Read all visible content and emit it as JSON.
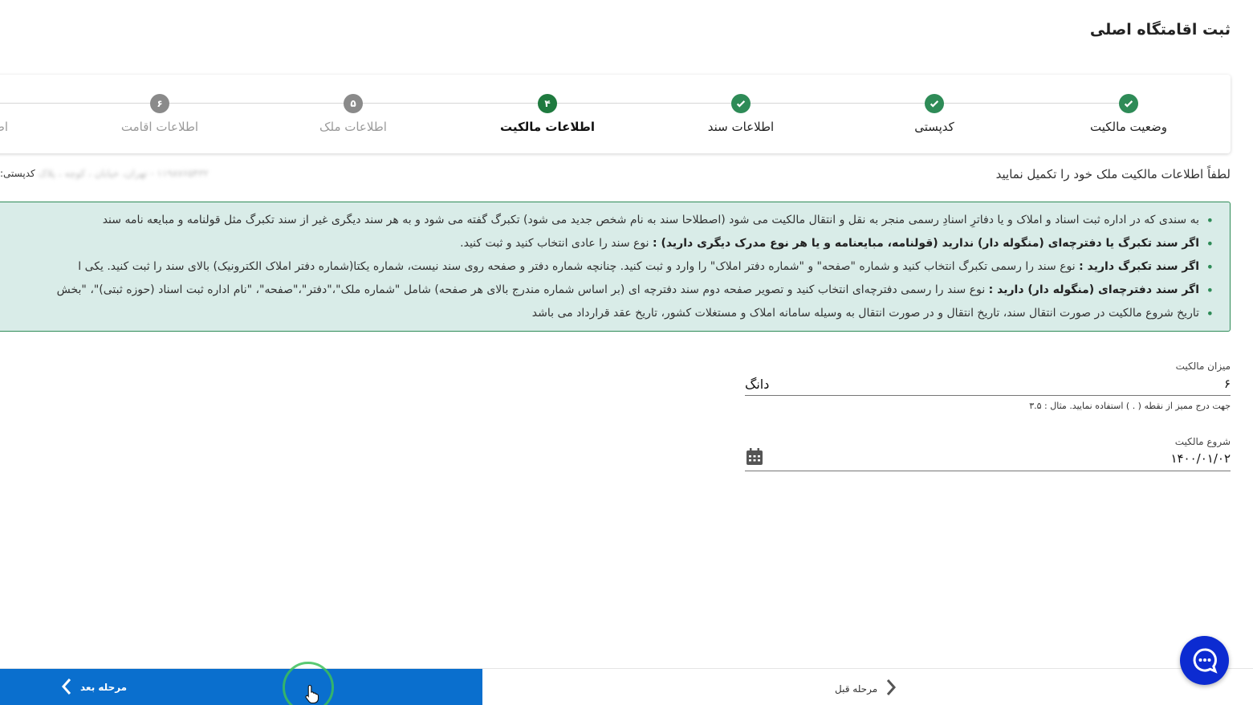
{
  "page": {
    "title": "ثبت اقامتگاه اصلی"
  },
  "stepper": {
    "steps": [
      {
        "label": "وضعیت مالکیت",
        "state": "done",
        "number": ""
      },
      {
        "label": "کدپستی",
        "state": "done",
        "number": ""
      },
      {
        "label": "اطلاعات سند",
        "state": "done",
        "number": ""
      },
      {
        "label": "اطلاعات مالکیت",
        "state": "active",
        "number": "۴"
      },
      {
        "label": "اطلاعات ملک",
        "state": "todo",
        "number": "۵"
      },
      {
        "label": "اطلاعات اقامت",
        "state": "todo",
        "number": "۶"
      },
      {
        "label": "اطلاعات",
        "state": "todo",
        "number": ""
      }
    ]
  },
  "form": {
    "subheading": "لطفاً اطلاعات مالکیت ملک خود را تکمیل نمایید",
    "postal_label": "کدپستی:",
    "postal_value": "۱۱۹۸۷۶۵۴۳۲ - تهران، خیابان ، کوچه ، پلاک"
  },
  "info": {
    "item1": "به سندی که در اداره ثبت اسناد و املاک و یا دفاترِ اسنادِ رسمی منجر به نقل و انتقال مالکیت می شود (اصطلاحا سند به نام شخص جدید می شود) تکبرگ گفته می شود و به هر سند دیگری غیر از سند تکبرگ مثل قولنامه و مبایعه نامه سند",
    "item2_bold": "اگر سند تکبرگ یا دفترچه‌ای (منگوله دار) ندارید (قولنامه، مبایعنامه و یا هر نوع مدرک دیگری دارید) :",
    "item2_text": " نوع سند را عادی انتخاب کنید و ثبت کنید.",
    "item3_bold": "اگر سند تکبرگ دارید :",
    "item3_text": " نوع سند را رسمی تکبرگ انتخاب کنید و شماره \"صفحه\" و \"شماره دفتر املاک\" را وارد و ثبت کنید. چنانچه شماره دفتر و صفحه روی سند نیست، شماره یکتا(شماره دفتر املاک الکترونیک) بالای سند را ثبت کنید. یکی ا",
    "item4_bold": "اگر سند دفترچه‌ای (منگوله دار) دارید :",
    "item4_text": " نوع سند را رسمی دفترچه‌ای انتخاب کنید و تصویر صفحه دوم سند دفترچه ای (بر اساس شماره مندرج بالای هر صفحه) شامل \"شماره ملک\"،\"دفتر\"،\"صفحه\"، \"نام اداره ثبت اسناد (حوزه ثبتی)\"، \"بخش",
    "item5": "تاریخ شروع مالکیت در صورت انتقال سند، تاریخ انتقال و در صورت انتقال به وسیله سامانه املاک و مستغلات کشور، تاریخ عقد قرارداد می باشد"
  },
  "ownership": {
    "label": "میزان مالکیت",
    "value": "۶",
    "unit": "دانگ",
    "hint": "جهت درج ممیز از نقطه ( . ) استفاده نمایید. مثال : ۳.۵"
  },
  "start": {
    "label": "شروع مالکیت",
    "value": "۱۴۰۰/۰۱/۰۲"
  },
  "footer": {
    "next_label": "مرحله بعد",
    "prev_label": "مرحله قبل"
  },
  "colors": {
    "primary": "#0a6fce",
    "success": "#2e8b57",
    "info_bg": "#d9ece8",
    "chat": "#0c2bd1"
  }
}
